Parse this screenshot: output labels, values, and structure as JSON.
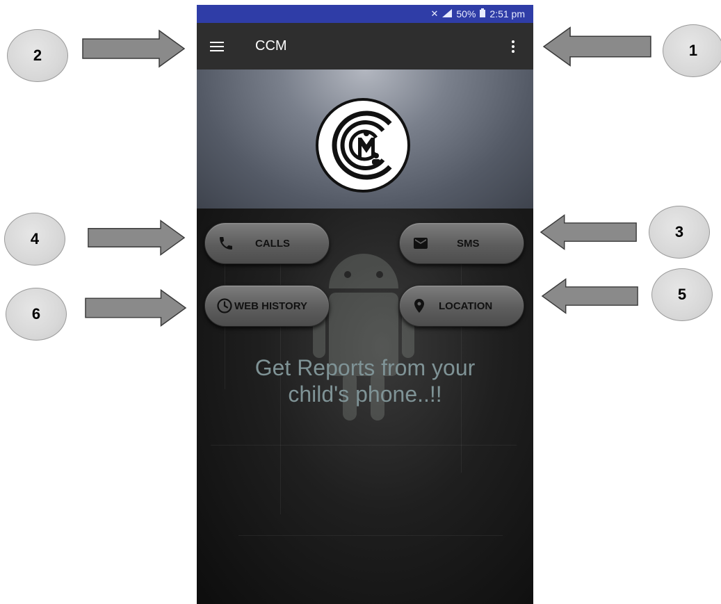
{
  "status_bar": {
    "battery": "50%",
    "time": "2:51 pm"
  },
  "app_bar": {
    "title": "CCM"
  },
  "buttons": {
    "calls": "CALLS",
    "sms": "SMS",
    "web_history": "WEB HISTORY",
    "location": "LOCATION"
  },
  "tagline": {
    "line1": "Get Reports from your",
    "line2": "child's phone..!!"
  },
  "annotations": [
    "1",
    "2",
    "3",
    "4",
    "5",
    "6"
  ],
  "colors": {
    "status_bar": "#2f3da7",
    "app_bar": "#2e2e2e",
    "tagline": "#7f9396"
  }
}
